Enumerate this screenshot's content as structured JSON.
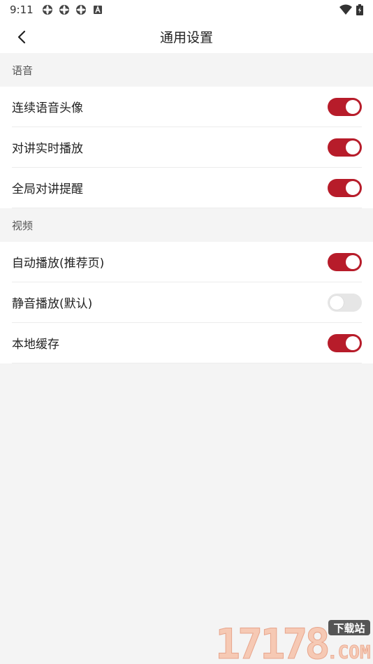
{
  "status_bar": {
    "time": "9:11",
    "icons": [
      "settings-sync-icon",
      "settings-sync-icon",
      "settings-sync-icon",
      "a-badge-icon"
    ],
    "right_icons": [
      "wifi-icon",
      "battery-icon"
    ]
  },
  "header": {
    "title": "通用设置",
    "back_icon": "chevron-left-icon"
  },
  "sections": [
    {
      "label": "语音",
      "items": [
        {
          "label": "连续语音头像",
          "enabled": true
        },
        {
          "label": "对讲实时播放",
          "enabled": true
        },
        {
          "label": "全局对讲提醒",
          "enabled": true
        }
      ]
    },
    {
      "label": "视频",
      "items": [
        {
          "label": "自动播放(推荐页)",
          "enabled": true
        },
        {
          "label": "静音播放(默认)",
          "enabled": false
        },
        {
          "label": "本地缓存",
          "enabled": true
        }
      ]
    }
  ],
  "colors": {
    "accent": "#b71c2a",
    "toggle_off": "#e6e6e6",
    "background": "#f4f4f4"
  },
  "watermark": {
    "number": "17178",
    "badge": "下载站",
    "suffix": ".COM"
  }
}
